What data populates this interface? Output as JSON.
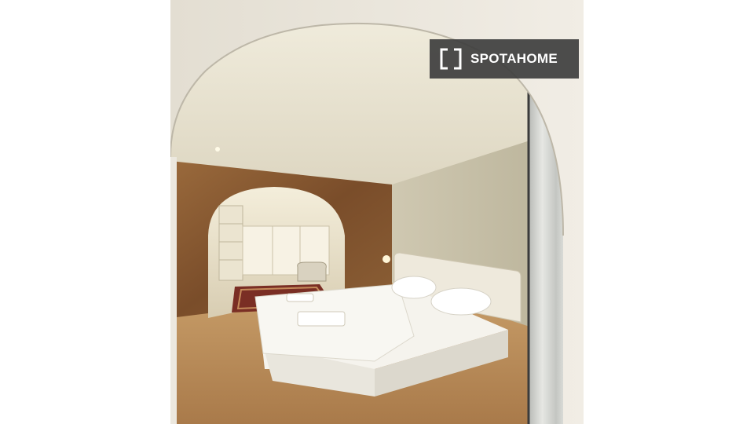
{
  "image": {
    "subject": "bedroom",
    "palette": {
      "wall": "#e7e1cf",
      "brick": "#8a5a32",
      "floor": "#b98a58",
      "bedding": "#f3f1ea",
      "curtain": "#d5d6d2",
      "frame": "#e9e4da"
    }
  },
  "watermark": {
    "brand": "SPOTAHOME",
    "icon": "spotahome-bracket-icon",
    "background": "#3e3e3e",
    "text_color": "#ffffff"
  }
}
